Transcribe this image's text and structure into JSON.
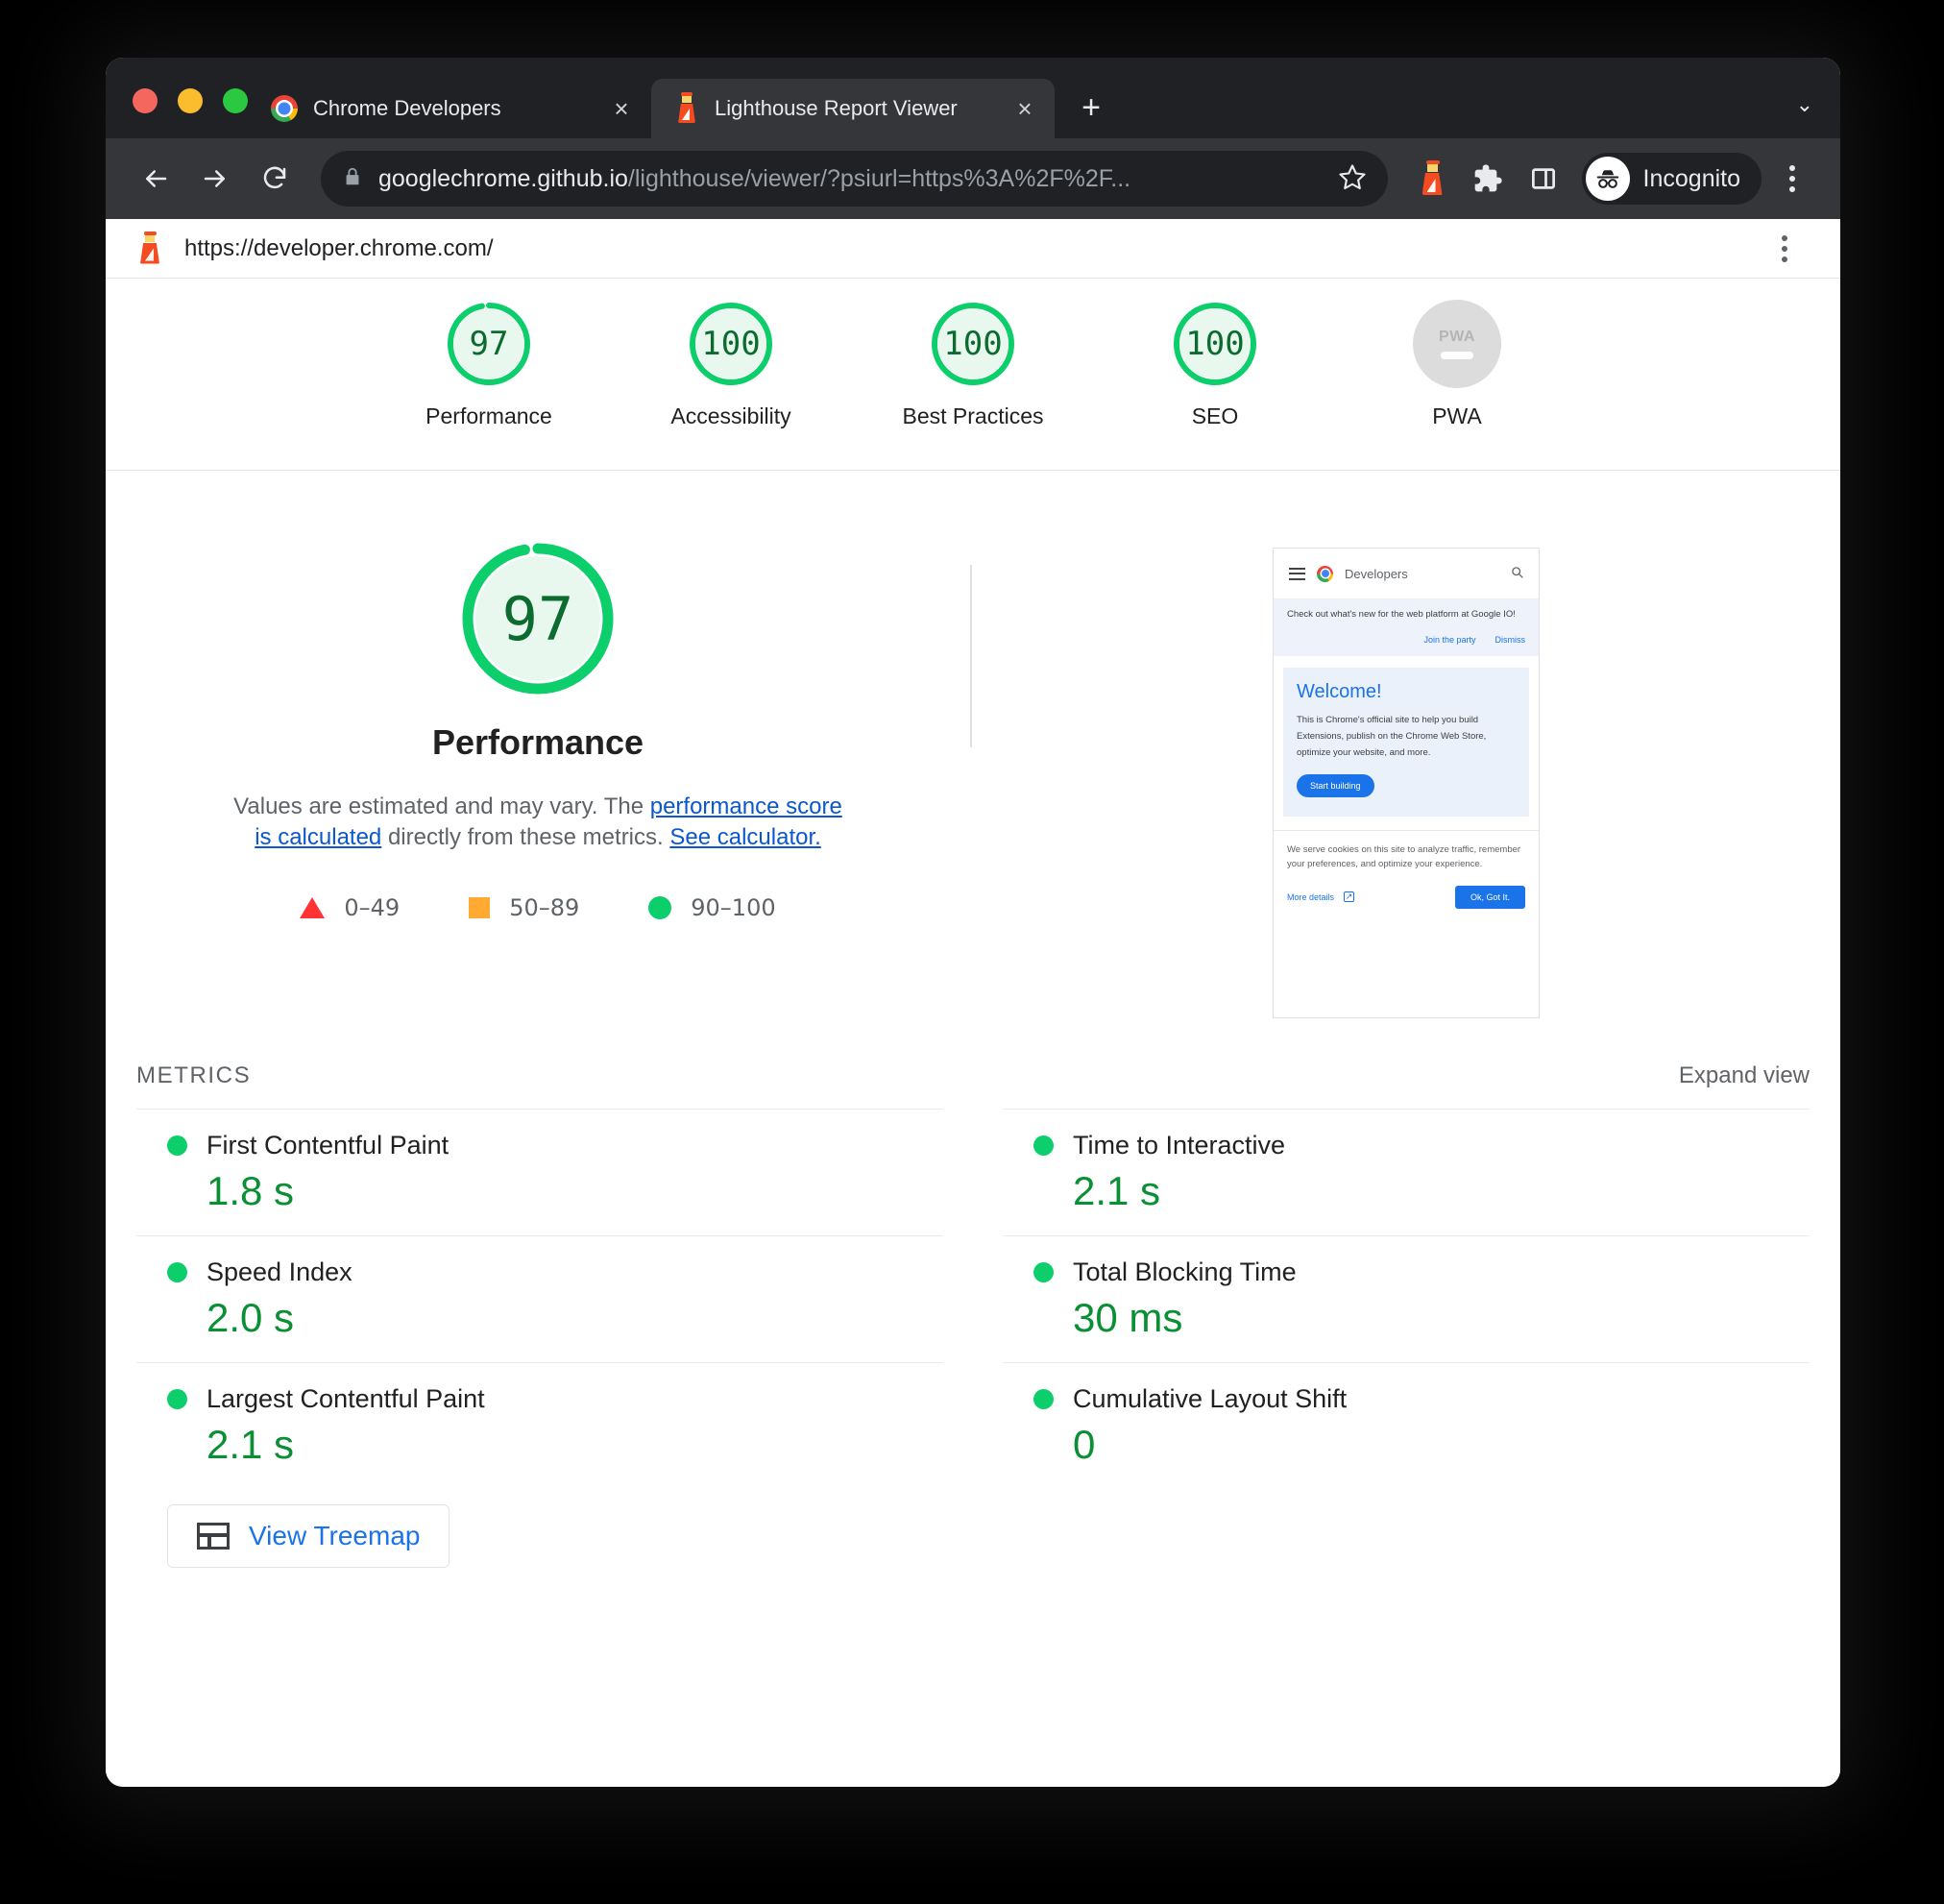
{
  "browser": {
    "tabs": [
      {
        "title": "Chrome Developers",
        "favicon": "chrome-icon",
        "active": false,
        "close_label": "×"
      },
      {
        "title": "Lighthouse Report Viewer",
        "favicon": "lighthouse-icon",
        "active": true,
        "close_label": "×"
      }
    ],
    "new_tab_label": "+",
    "tabstrip_menu_label": "⌄",
    "omnibox": {
      "domain": "googlechrome.github.io",
      "path": "/lighthouse/viewer/?psiurl=https%3A%2F%2F...",
      "lock_icon": "lock-icon",
      "star_icon": "bookmark-star-icon"
    },
    "toolbar_icons": [
      "back-arrow-icon",
      "forward-arrow-icon",
      "reload-icon",
      "lighthouse-extension-icon",
      "extensions-puzzle-icon",
      "side-panel-icon"
    ],
    "profile": {
      "label": "Incognito",
      "icon": "incognito-icon"
    },
    "menu_icon": "three-dot-menu-icon"
  },
  "lighthouse": {
    "topbar": {
      "site_url": "https://developer.chrome.com/",
      "brand_icon": "lighthouse-icon",
      "menu_icon": "three-dot-menu-icon"
    },
    "category_scores": [
      {
        "label": "Performance",
        "score": "97",
        "value": 97,
        "state": "pass"
      },
      {
        "label": "Accessibility",
        "score": "100",
        "value": 100,
        "state": "pass"
      },
      {
        "label": "Best Practices",
        "score": "100",
        "value": 100,
        "state": "pass"
      },
      {
        "label": "SEO",
        "score": "100",
        "value": 100,
        "state": "pass"
      },
      {
        "label": "PWA",
        "score": "PWA",
        "value": null,
        "state": "not-applicable"
      }
    ],
    "performance": {
      "score": "97",
      "title": "Performance",
      "description_prefix": "Values are estimated and may vary. The ",
      "link1": "performance score is calculated",
      "description_middle": " directly from these metrics. ",
      "link2": "See calculator.",
      "legend": [
        {
          "icon": "triangle-fail-icon",
          "range": "0–49",
          "color": "#ff3333"
        },
        {
          "icon": "square-average-icon",
          "range": "50–89",
          "color": "#ffaa33"
        },
        {
          "icon": "circle-pass-icon",
          "range": "90–100",
          "color": "#0cce6b"
        }
      ]
    },
    "screenshot_thumbnail": {
      "brand": "Developers",
      "banner_text": "Check out what's new for the web platform at Google IO!",
      "banner_action_primary": "Join the party",
      "banner_action_secondary": "Dismiss",
      "hero_heading": "Welcome!",
      "hero_text": "This is Chrome's official site to help you build Extensions, publish on the Chrome Web Store, optimize your website, and more.",
      "hero_button": "Start building",
      "cookie_text": "We serve cookies on this site to analyze traffic, remember your preferences, and optimize your experience.",
      "cookie_more": "More details",
      "cookie_ok": "Ok, Got It."
    },
    "metrics_section": {
      "title": "METRICS",
      "expand_label": "Expand view",
      "metrics": [
        {
          "name": "First Contentful Paint",
          "value": "1.8 s",
          "state": "pass"
        },
        {
          "name": "Time to Interactive",
          "value": "2.1 s",
          "state": "pass"
        },
        {
          "name": "Speed Index",
          "value": "2.0 s",
          "state": "pass"
        },
        {
          "name": "Total Blocking Time",
          "value": "30 ms",
          "state": "pass"
        },
        {
          "name": "Largest Contentful Paint",
          "value": "2.1 s",
          "state": "pass"
        },
        {
          "name": "Cumulative Layout Shift",
          "value": "0",
          "state": "pass"
        }
      ]
    },
    "treemap_button": {
      "label": "View Treemap",
      "icon": "treemap-icon"
    }
  },
  "colors": {
    "pass_green": "#0cce6b",
    "score_text_green": "#0a8f34",
    "average_orange": "#ffaa33",
    "fail_red": "#ff3333",
    "link_blue": "#0b57d0",
    "chrome_dark": "#202124"
  }
}
